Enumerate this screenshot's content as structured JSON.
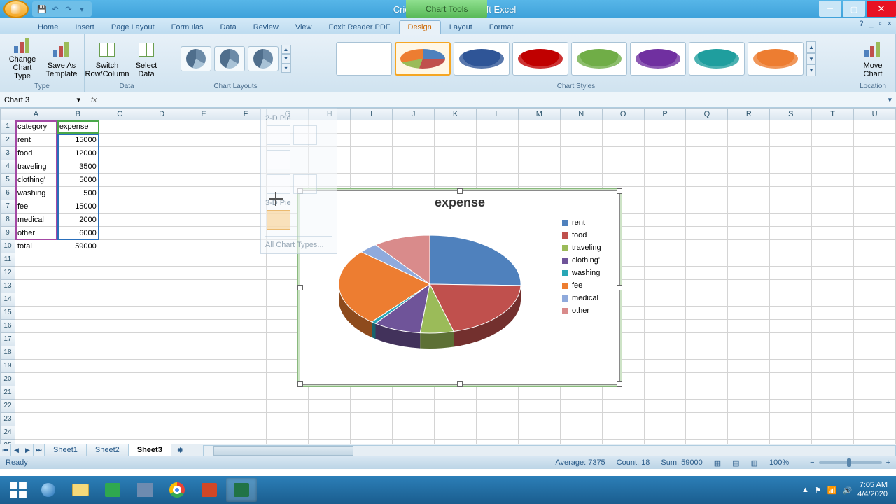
{
  "window": {
    "title": "Cricket Chart - Microsoft Excel",
    "chart_tools_label": "Chart Tools"
  },
  "qat": {
    "save": "💾",
    "undo": "↶",
    "redo": "↷",
    "more": "▾"
  },
  "win": {
    "min": "─",
    "max": "▢",
    "close": "✕"
  },
  "tabs": {
    "items": [
      "Home",
      "Insert",
      "Page Layout",
      "Formulas",
      "Data",
      "Review",
      "View",
      "Foxit Reader PDF",
      "Design",
      "Layout",
      "Format"
    ],
    "active": "Design",
    "help": "?"
  },
  "ribbon": {
    "type_group": "Type",
    "change_type": "Change\nChart Type",
    "save_template": "Save As\nTemplate",
    "data_group": "Data",
    "switch": "Switch\nRow/Column",
    "select_data": "Select\nData",
    "layouts_group": "Chart Layouts",
    "styles_group": "Chart Styles",
    "location_group": "Location",
    "move_chart": "Move\nChart"
  },
  "style_colors": [
    "#555",
    "#4472c4",
    "#2f5597",
    "#c00000",
    "#70ad47",
    "#7030a0",
    "#1f9e9e",
    "#ed7d31"
  ],
  "name_box": "Chart 3",
  "fx_label": "fx",
  "columns": [
    "A",
    "B",
    "C",
    "D",
    "E",
    "F",
    "G",
    "H",
    "I",
    "J",
    "K",
    "L",
    "M",
    "N",
    "O",
    "P",
    "Q",
    "R",
    "S",
    "T",
    "U"
  ],
  "sheet": {
    "headers": [
      "category",
      "expense"
    ],
    "rows": [
      [
        "rent",
        15000
      ],
      [
        "food",
        12000
      ],
      [
        "traveling",
        3500
      ],
      [
        "clothing'",
        5000
      ],
      [
        "washing",
        500
      ],
      [
        "fee",
        15000
      ],
      [
        "medical",
        2000
      ],
      [
        "other",
        6000
      ]
    ],
    "total_label": "total",
    "total_value": 59000
  },
  "chart_data": {
    "type": "pie",
    "title": "expense",
    "categories": [
      "rent",
      "food",
      "traveling",
      "clothing'",
      "washing",
      "fee",
      "medical",
      "other"
    ],
    "values": [
      15000,
      12000,
      3500,
      5000,
      500,
      15000,
      2000,
      6000
    ],
    "colors": [
      "#4f81bd",
      "#c0504d",
      "#9bbb59",
      "#6f5499",
      "#28a6b5",
      "#ed7d31",
      "#8faadc",
      "#d98b8b"
    ]
  },
  "pie_menu": {
    "h1": "2-D Pie",
    "h2": "3-D Pie",
    "all": "All Chart Types..."
  },
  "sheet_tabs": {
    "items": [
      "Sheet1",
      "Sheet2",
      "Sheet3"
    ],
    "active": "Sheet3"
  },
  "status": {
    "ready": "Ready",
    "avg_label": "Average:",
    "avg": "7375",
    "count_label": "Count:",
    "count": "18",
    "sum_label": "Sum:",
    "sum": "59000",
    "zoom": "100%",
    "zoom_minus": "−",
    "zoom_plus": "+"
  },
  "tray": {
    "time": "7:05 AM",
    "date": "4/4/2020"
  }
}
